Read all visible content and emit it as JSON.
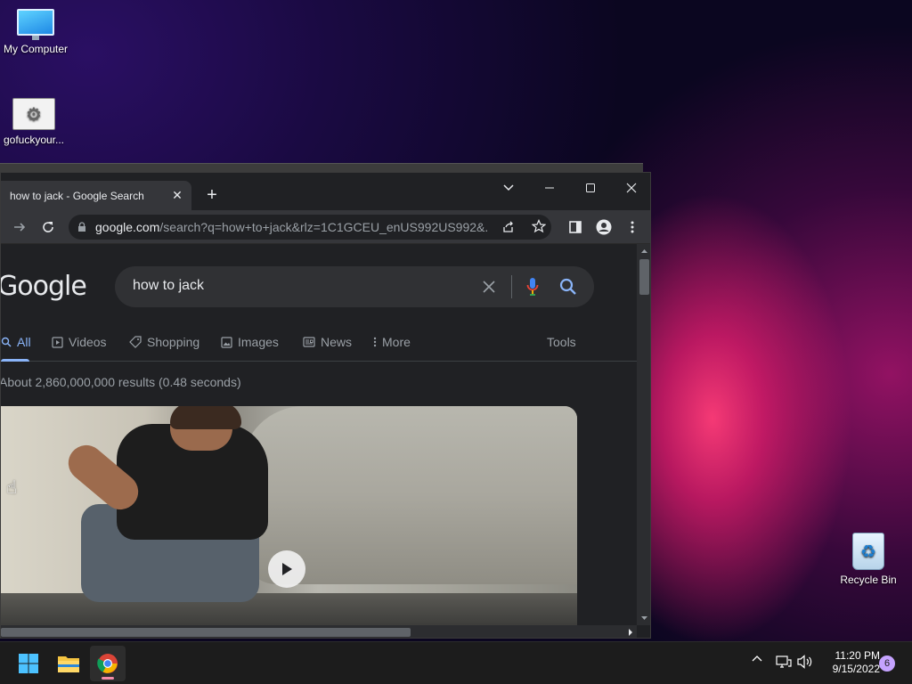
{
  "desktop": {
    "icons": [
      {
        "label": "My Computer",
        "icon": "monitor-icon"
      },
      {
        "label": "gofuckyour...",
        "icon": "settings-file-icon"
      },
      {
        "label": "Recycle Bin",
        "icon": "recycle-bin-icon"
      }
    ]
  },
  "browser": {
    "tab_title": "how to jack - Google Search",
    "tab_close": "✕",
    "new_tab": "+",
    "url_host": "google.com",
    "url_path": "/search?q=how+to+jack&rlz=1C1GCEU_enUS992US992&...",
    "logo": "Google",
    "search_query": "how to jack",
    "nav_tabs": [
      {
        "label": "All",
        "icon": "search-icon"
      },
      {
        "label": "Videos",
        "icon": "video-icon"
      },
      {
        "label": "Shopping",
        "icon": "tag-icon"
      },
      {
        "label": "Images",
        "icon": "image-icon"
      },
      {
        "label": "News",
        "icon": "news-icon"
      },
      {
        "label": "More",
        "icon": "more-vertical-icon"
      }
    ],
    "tools_label": "Tools",
    "result_stats": "About 2,860,000,000 results (0.48 seconds)"
  },
  "taskbar": {
    "apps": [
      "start-icon",
      "file-explorer-icon",
      "chrome-icon"
    ],
    "time": "11:20 PM",
    "date": "9/15/2022",
    "notifications": "6"
  },
  "colors": {
    "accent": "#8ab4f8",
    "chrome_dark": "#202124",
    "toolbar": "#35363a"
  }
}
